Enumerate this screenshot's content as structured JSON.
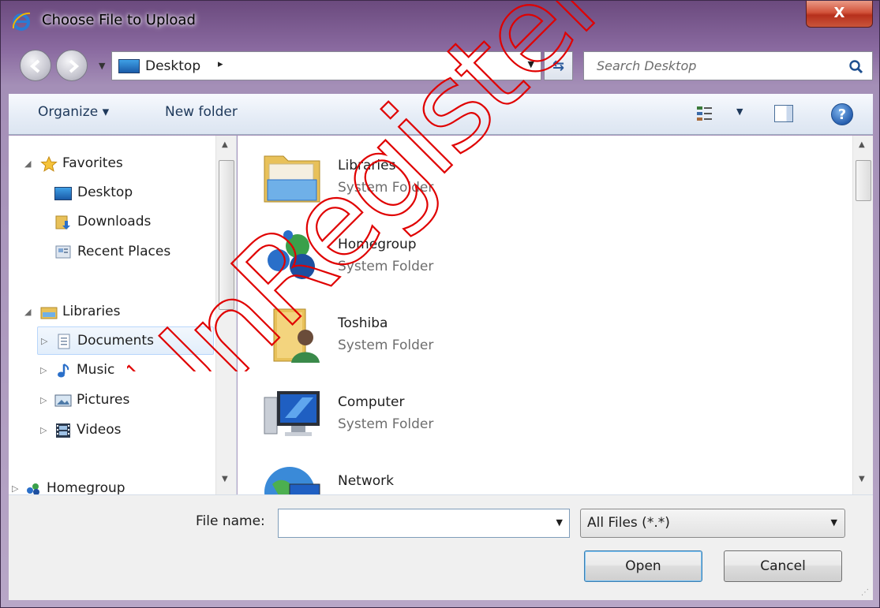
{
  "window": {
    "title": "Choose File to Upload",
    "close_label": "X",
    "frame_color": "#8a6aa0"
  },
  "address_bar": {
    "location": "Desktop",
    "separator": "▸",
    "back_icon": "back-arrow-icon",
    "forward_icon": "forward-arrow-icon",
    "refresh_icon": "refresh-icon"
  },
  "search": {
    "placeholder": "Search Desktop"
  },
  "toolbar": {
    "organize_label": "Organize ▾",
    "new_folder_label": "New folder",
    "help_label": "?"
  },
  "navigation": {
    "favorites": {
      "label": "Favorites",
      "items": [
        {
          "label": "Desktop",
          "icon": "desktop-icon"
        },
        {
          "label": "Downloads",
          "icon": "downloads-icon"
        },
        {
          "label": "Recent Places",
          "icon": "recent-places-icon"
        }
      ]
    },
    "libraries": {
      "label": "Libraries",
      "items": [
        {
          "label": "Documents",
          "icon": "documents-icon",
          "selected": true
        },
        {
          "label": "Music",
          "icon": "music-icon"
        },
        {
          "label": "Pictures",
          "icon": "pictures-icon"
        },
        {
          "label": "Videos",
          "icon": "videos-icon"
        }
      ]
    },
    "homegroup": {
      "label": "Homegroup"
    }
  },
  "files": [
    {
      "name": "Libraries",
      "type": "System Folder",
      "icon": "libraries-folder-icon"
    },
    {
      "name": "Homegroup",
      "type": "System Folder",
      "icon": "homegroup-icon"
    },
    {
      "name": "Toshiba",
      "type": "System Folder",
      "icon": "user-folder-icon"
    },
    {
      "name": "Computer",
      "type": "System Folder",
      "icon": "computer-icon"
    },
    {
      "name": "Network",
      "type": "",
      "icon": "network-icon"
    }
  ],
  "footer": {
    "file_name_label": "File name:",
    "file_name_value": "",
    "file_type_value": "All Files (*.*)",
    "open_label": "Open",
    "cancel_label": "Cancel"
  },
  "watermark": {
    "text": "UnRegistered",
    "color": "#e00000"
  }
}
